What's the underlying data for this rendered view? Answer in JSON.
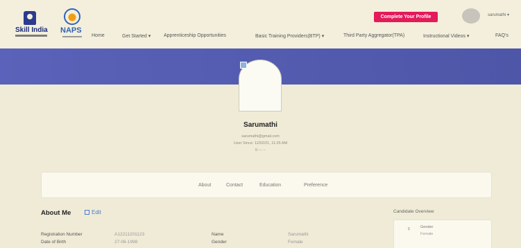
{
  "header": {
    "logos": {
      "skill_india": "Skill India",
      "naps": "NAPS"
    },
    "nav": [
      "Home",
      "Get Started ▾",
      "Apprenticeship Opportunities",
      "Basic Training Providers(BTP) ▾",
      "Third Party Aggregator(TPA)",
      "Instructional Videos ▾",
      "FAQ's"
    ],
    "cta_label": "Complete Your Profile",
    "user_label": "sarumathi ▾"
  },
  "profile": {
    "name": "Sarumathi",
    "email": "sarumathi@gmail.com",
    "user_since": "User Since: 12/02/21, 11:25 AM",
    "location": "0 --- --"
  },
  "tabs": [
    "About",
    "Contact",
    "Education",
    "Preference"
  ],
  "about": {
    "title": "About Me",
    "edit_label": "Edit",
    "rows": [
      {
        "label": "Registration Number",
        "value": "A12211201123",
        "label2": "Name",
        "value2": "Sarumathi"
      },
      {
        "label": "Date of Birth",
        "value": "27-06-1998",
        "label2": "Gender",
        "value2": "Female"
      }
    ]
  },
  "overview": {
    "title": "Candidate Overview",
    "gender_label": "Gender",
    "gender_value": "Female",
    "gender_icon": "female-icon"
  },
  "colors": {
    "banner": "#5a62b9",
    "cta": "#e21b5a",
    "link": "#4a7ad0",
    "page_bg": "#efebd6"
  }
}
